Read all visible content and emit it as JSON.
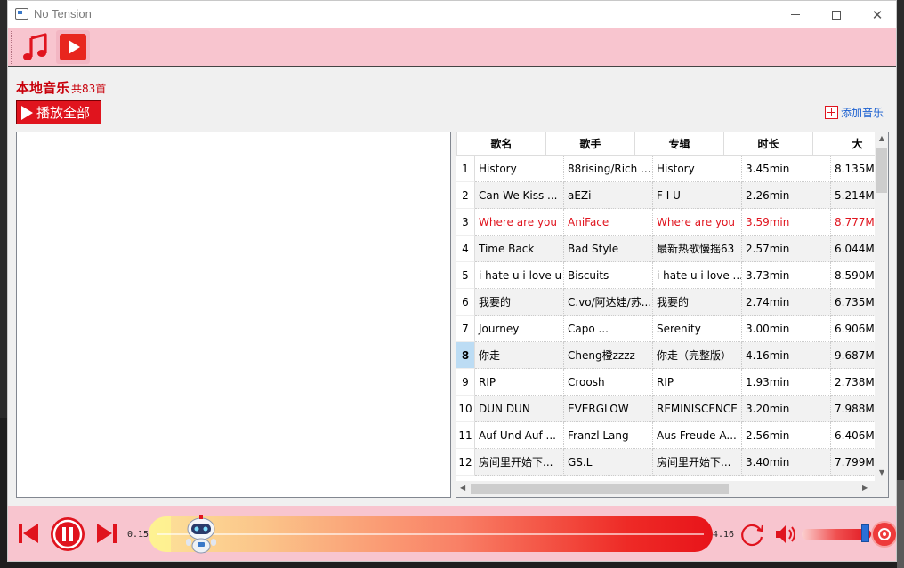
{
  "window": {
    "title": "No Tension"
  },
  "toolbar": {
    "music_icon": "music-note-icon",
    "video_icon": "video-play-icon"
  },
  "library": {
    "title": "本地音乐",
    "count": "共83首",
    "play_all_label": "播放全部",
    "add_music_label": "添加音乐"
  },
  "table": {
    "columns": [
      "歌名",
      "歌手",
      "专辑",
      "时长",
      "大"
    ],
    "rows": [
      {
        "num": "1",
        "title": "History",
        "artist": "88rising/Rich ...",
        "album": "History",
        "duration": "3.45min",
        "size": "8.135M"
      },
      {
        "num": "2",
        "title": "Can We Kiss ...",
        "artist": "aEZi",
        "album": "F I U",
        "duration": "2.26min",
        "size": "5.214M"
      },
      {
        "num": "3",
        "title": "Where are you",
        "artist": "AniFace",
        "album": "Where are you",
        "duration": "3.59min",
        "size": "8.777M"
      },
      {
        "num": "4",
        "title": "Time Back",
        "artist": "Bad Style",
        "album": "最新热歌慢摇63",
        "duration": "2.57min",
        "size": "6.044M"
      },
      {
        "num": "5",
        "title": "i hate u i love u",
        "artist": "Biscuits",
        "album": "i hate u i love ...",
        "duration": "3.73min",
        "size": "8.590M"
      },
      {
        "num": "6",
        "title": "我要的",
        "artist": "C.vo/阿达娃/苏...",
        "album": "我要的",
        "duration": "2.74min",
        "size": "6.735M"
      },
      {
        "num": "7",
        "title": "Journey",
        "artist": "Capo ...",
        "album": "Serenity",
        "duration": "3.00min",
        "size": "6.906M"
      },
      {
        "num": "8",
        "title": "你走",
        "artist": "Cheng橙zzzz",
        "album": "你走（完整版）",
        "duration": "4.16min",
        "size": "9.687M"
      },
      {
        "num": "9",
        "title": "RIP",
        "artist": "Croosh",
        "album": "RIP",
        "duration": "1.93min",
        "size": "2.738M"
      },
      {
        "num": "10",
        "title": "DUN DUN",
        "artist": "EVERGLOW",
        "album": "REMINISCENCE",
        "duration": "3.20min",
        "size": "7.988M"
      },
      {
        "num": "11",
        "title": "Auf Und Auf ...",
        "artist": "Franzl Lang",
        "album": "Aus Freude A...",
        "duration": "2.56min",
        "size": "6.406M"
      },
      {
        "num": "12",
        "title": "房间里开始下...",
        "artist": "GS.L",
        "album": "房间里开始下...",
        "duration": "3.40min",
        "size": "7.799M"
      }
    ],
    "playing_row": 3,
    "selected_row": 8
  },
  "player": {
    "current_time": "0.15",
    "total_time": "4.16",
    "progress_fraction": 0.04,
    "volume_fraction": 0.9,
    "prev_icon": "skip-previous-icon",
    "pause_icon": "pause-icon",
    "next_icon": "skip-next-icon",
    "repeat_icon": "repeat-icon",
    "volume_icon": "volume-icon",
    "mascot": "robot-mascot"
  },
  "colors": {
    "accent": "#e0141e",
    "toolbar_bg": "#f8c5cf",
    "selected_row": "#bcdcf4"
  }
}
